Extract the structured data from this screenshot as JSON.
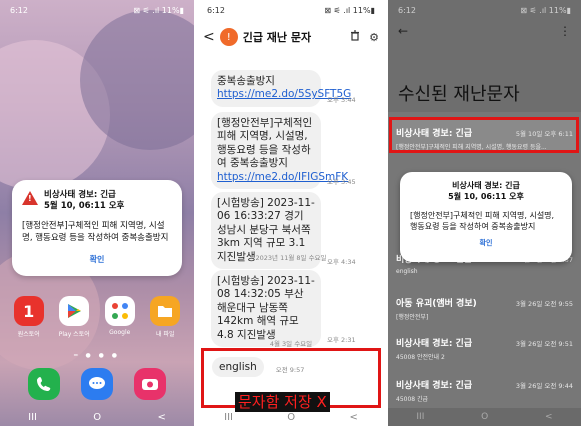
{
  "home": {
    "status_time": "6:12",
    "status_icons": "⊠ ⚟ .ıl 11%▮",
    "alert": {
      "title_line1": "비상사태 경보: 긴급",
      "title_line2": "5월 10, 06:11 오후",
      "body": "[행정안전부]구체적인 피해 지역명, 시설명, 행동요령 등을 작성하여 중복송출방지",
      "ok": "확인"
    },
    "apps": [
      {
        "label": "원스토어",
        "icon": "onestore-icon",
        "color": "#e8322c"
      },
      {
        "label": "Play 스토어",
        "icon": "play-store-icon",
        "color": "#ffffff"
      },
      {
        "label": "Google",
        "icon": "google-folder-icon",
        "color": "#ffffff"
      },
      {
        "label": "내 파일",
        "icon": "my-files-icon",
        "color": "#f6a623"
      }
    ],
    "dock": [
      {
        "icon": "phone-icon",
        "color": "#23b14d"
      },
      {
        "icon": "messages-icon",
        "color": "#2c7cf0"
      },
      {
        "icon": "camera-icon",
        "color": "#e8326a"
      }
    ],
    "nav": [
      "III",
      "O",
      "<"
    ]
  },
  "conversation": {
    "status_time": "6:12",
    "status_icons": "⊠ ⚟ .ıl 11%▮",
    "title": "긴급 재난 문자",
    "messages": [
      {
        "text_pre": "중복송출방지 ",
        "link": "https://me2.do/5SySFT5G",
        "time": "오후 3:44"
      },
      {
        "text_pre": "[행정안전부]구체적인 피해 지역명, 시설명, 행동요령 등을 작성하여 중복송출방지 ",
        "link": "https://me2.do/IFIGSmFK",
        "time": "오후 3:45"
      },
      {
        "text_pre": "[시험방송] 2023-11-06 16:33:27 경기 성남시 분당구 북서쪽 3km 지역 규모 3.1 지진발생",
        "link": "",
        "time": "오후 4:34"
      },
      {
        "text_pre": "[시험방송] 2023-11-08 14:32:05 부산 해운대구 남동쪽 142km 해역 규모 4.8 지진발생",
        "link": "",
        "time": "오후 2:31"
      }
    ],
    "date_sep_1": "2023년 11월 8일 수요일",
    "date_sep_2": "4월 3일 수요일",
    "last_message": {
      "text": "english",
      "time": "오전 9:57"
    },
    "overlay_caption": "문자함 저장 X",
    "nav": [
      "III",
      "O",
      "<"
    ]
  },
  "disaster_list": {
    "status_time": "6:12",
    "status_icons": "⊠ ⚟ .ıl 11%▮",
    "back": "←",
    "menu": "⋮",
    "title": "수신된 재난문자",
    "items": [
      {
        "title": "비상사태 경보: 긴급",
        "time": "5월 10일 오후 6:11",
        "sub": "[행정안전부]구체적인 피해 지역명, 시설명, 행동요령 등을..."
      },
      {
        "title": "비상사태 경보: 긴급",
        "time": "4월 3일 오전 9:57",
        "sub": "english"
      },
      {
        "title": "아동 유괴(앰버 경보)",
        "time": "3월 26일 오전 9:55",
        "sub": "[행정안전부]"
      },
      {
        "title": "비상사태 경보: 긴급",
        "time": "3월 26일 오전 9:51",
        "sub": "45008 안전안내 2"
      },
      {
        "title": "비상사태 경보: 긴급",
        "time": "3월 26일 오전 9:44",
        "sub": "45008 긴급"
      }
    ],
    "dialog": {
      "title_line1": "비상사태 경보: 긴급",
      "title_line2": "5월 10, 06:11 오후",
      "body": "[행정안전부]구체적인 피해 지역명, 시설명, 행동요령 등을 작성하여 중복송출방지",
      "ok": "확인"
    },
    "nav": [
      "III",
      "O",
      "<"
    ]
  }
}
